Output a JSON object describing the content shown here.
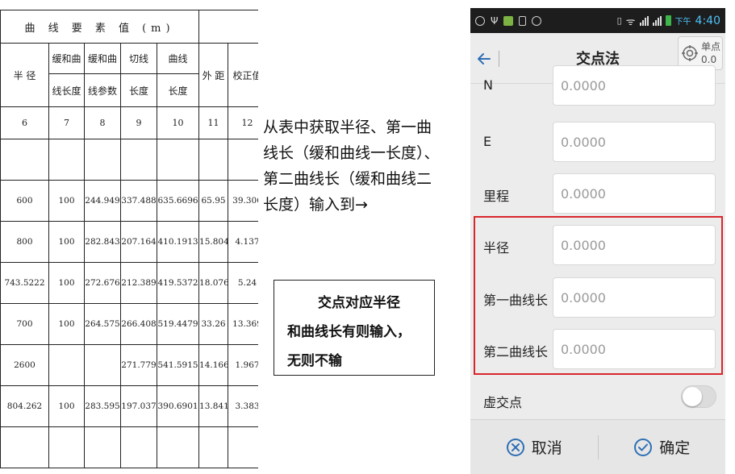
{
  "table": {
    "title": "曲 线 要 素 值 (m)",
    "headers": {
      "radius": "半 径",
      "transition_top": "缓和曲",
      "transition_bottom": "线长度",
      "param_top": "缓和曲",
      "param_bottom": "线参数",
      "tangent_top": "切线",
      "tangent_bottom": "长度",
      "curve_top": "曲线",
      "curve_bottom": "长度",
      "external": "外 距",
      "correction": "校正值"
    },
    "col_numbers": [
      "6",
      "7",
      "8",
      "9",
      "10",
      "11",
      "12"
    ],
    "rows": [
      [
        "",
        "",
        "",
        "",
        "",
        "",
        ""
      ],
      [
        "600",
        "100",
        "244.949",
        "337.488",
        "635.6696",
        "65.95",
        "39.306"
      ],
      [
        "800",
        "100",
        "282.843",
        "207.164",
        "410.1913",
        "15.804",
        "4.137"
      ],
      [
        "743.5222",
        "100",
        "272.676",
        "212.389",
        "419.5372",
        "18.076",
        "5.24"
      ],
      [
        "700",
        "100",
        "264.575",
        "266.408",
        "519.4479",
        "33.26",
        "13.369"
      ],
      [
        "2600",
        "",
        "",
        "271.779",
        "541.5915",
        "14.166",
        "1.967"
      ],
      [
        "804.262",
        "100",
        "283.595",
        "197.037",
        "390.6901",
        "13.841",
        "3.383"
      ],
      [
        "",
        "",
        "",
        "",
        "",
        "",
        ""
      ]
    ]
  },
  "instruction": {
    "lines": [
      "从表中获取半径、第一曲",
      "线长（缓和曲线一长度）、",
      "第二曲线长（缓和曲线二",
      "长度）输入到→"
    ]
  },
  "note": {
    "lines": [
      "交点对应半径",
      "和曲线长有则输入，",
      "无则不输"
    ]
  },
  "phone": {
    "status": {
      "ampm": "下午",
      "time": "4:40"
    },
    "title": "交点法",
    "single_point": {
      "label": "单点",
      "value": "0.0"
    },
    "fields": [
      {
        "label": "N",
        "value": "0.0000"
      },
      {
        "label": "E",
        "value": "0.0000"
      },
      {
        "label": "里程",
        "value": "0.0000"
      },
      {
        "label": "半径",
        "value": "0.0000"
      },
      {
        "label": "第一曲线长",
        "value": "0.0000"
      },
      {
        "label": "第二曲线长",
        "value": "0.0000"
      }
    ],
    "virtual_point": {
      "label": "虚交点",
      "on": false
    },
    "buttons": {
      "cancel": "取消",
      "confirm": "确定"
    },
    "highlight_color": "#d9262c",
    "accent_color": "#4fc3f7"
  }
}
